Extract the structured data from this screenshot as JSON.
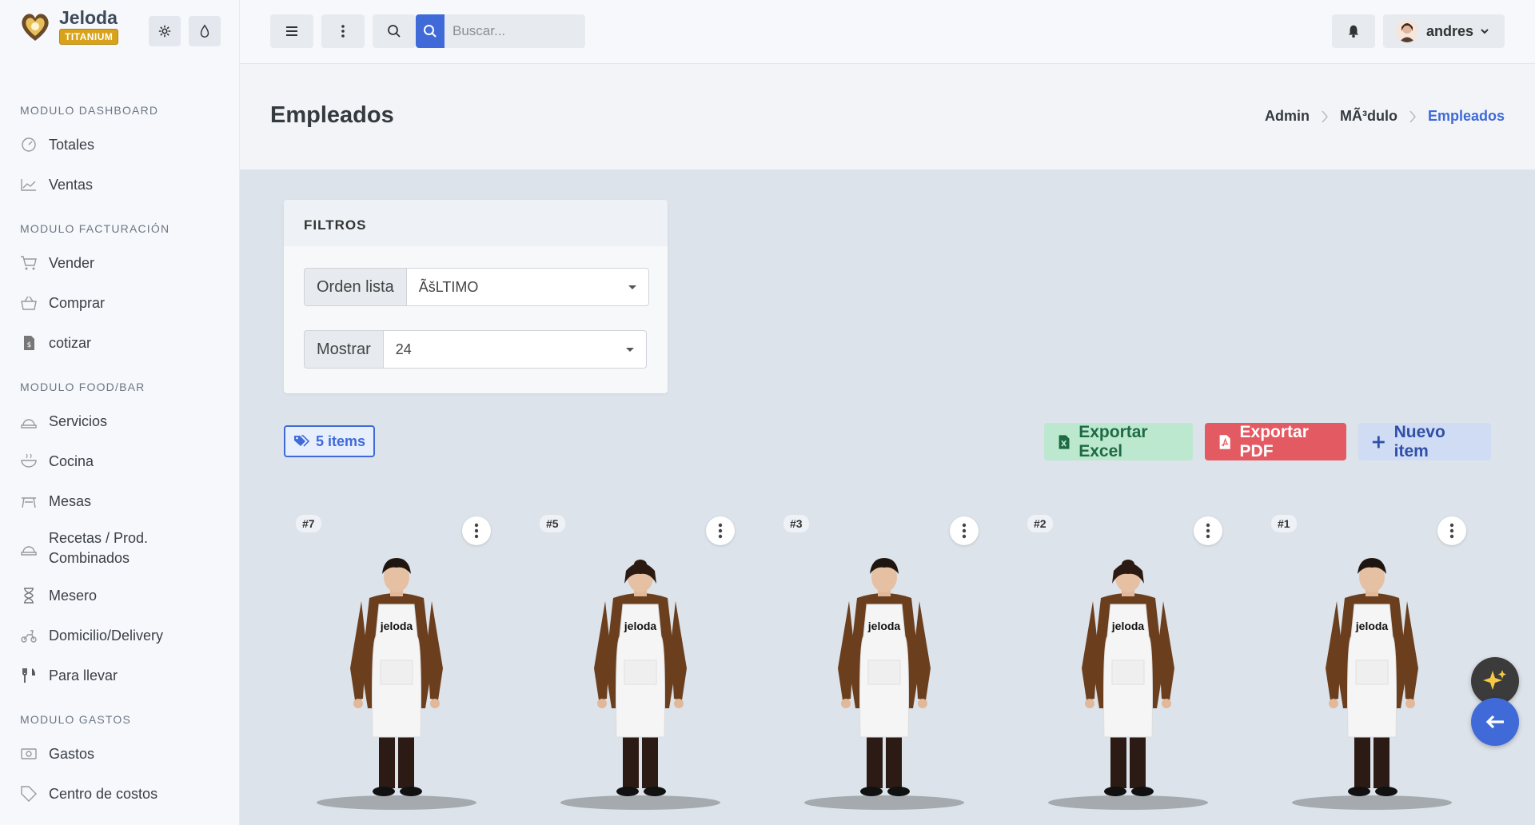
{
  "brand": {
    "name": "Jeloda",
    "badge": "TITANIUM"
  },
  "topbar": {
    "search_placeholder": "Buscar...",
    "user_name": "andres"
  },
  "sidebar": {
    "sections": [
      {
        "title": "MODULO DASHBOARD",
        "items": [
          {
            "label": "Totales",
            "icon": "gauge-icon"
          },
          {
            "label": "Ventas",
            "icon": "chart-line-icon"
          }
        ]
      },
      {
        "title": "MODULO FACTURACIÓN",
        "items": [
          {
            "label": "Vender",
            "icon": "cart-icon"
          },
          {
            "label": "Comprar",
            "icon": "basket-icon"
          },
          {
            "label": "cotizar",
            "icon": "invoice-icon"
          }
        ]
      },
      {
        "title": "MODULO FOOD/BAR",
        "items": [
          {
            "label": "Servicios",
            "icon": "service-icon"
          },
          {
            "label": "Cocina",
            "icon": "bowl-icon"
          },
          {
            "label": "Mesas",
            "icon": "table-icon"
          },
          {
            "label": "Recetas / Prod. Combinados",
            "icon": "recipe-icon"
          },
          {
            "label": "Mesero",
            "icon": "hourglass-icon"
          },
          {
            "label": "Domicilio/Delivery",
            "icon": "scooter-icon"
          },
          {
            "label": "Para llevar",
            "icon": "utensils-icon"
          }
        ]
      },
      {
        "title": "MODULO GASTOS",
        "items": [
          {
            "label": "Gastos",
            "icon": "money-icon"
          },
          {
            "label": "Centro de costos",
            "icon": "tag-icon"
          }
        ]
      }
    ]
  },
  "page": {
    "title": "Empleados",
    "breadcrumb": [
      "Admin",
      "MÃ³dulo",
      "Empleados"
    ]
  },
  "filters": {
    "title": "FILTROS",
    "order_label": "Orden lista",
    "order_value": "ÃšLTIMO",
    "show_label": "Mostrar",
    "show_value": "24"
  },
  "actions": {
    "items_count": "5 items",
    "export_excel": "Exportar Excel",
    "export_pdf": "Exportar PDF",
    "new_item": "Nuevo item"
  },
  "employees": [
    {
      "id": "#7",
      "gender": "male"
    },
    {
      "id": "#5",
      "gender": "female"
    },
    {
      "id": "#3",
      "gender": "male"
    },
    {
      "id": "#2",
      "gender": "female"
    },
    {
      "id": "#1",
      "gender": "male"
    }
  ],
  "apron_text": "jeloda",
  "colors": {
    "accent": "#3f6ad8",
    "pdf": "#e45a62",
    "excel": "#bde8d0",
    "badge": "#d9a21b"
  }
}
